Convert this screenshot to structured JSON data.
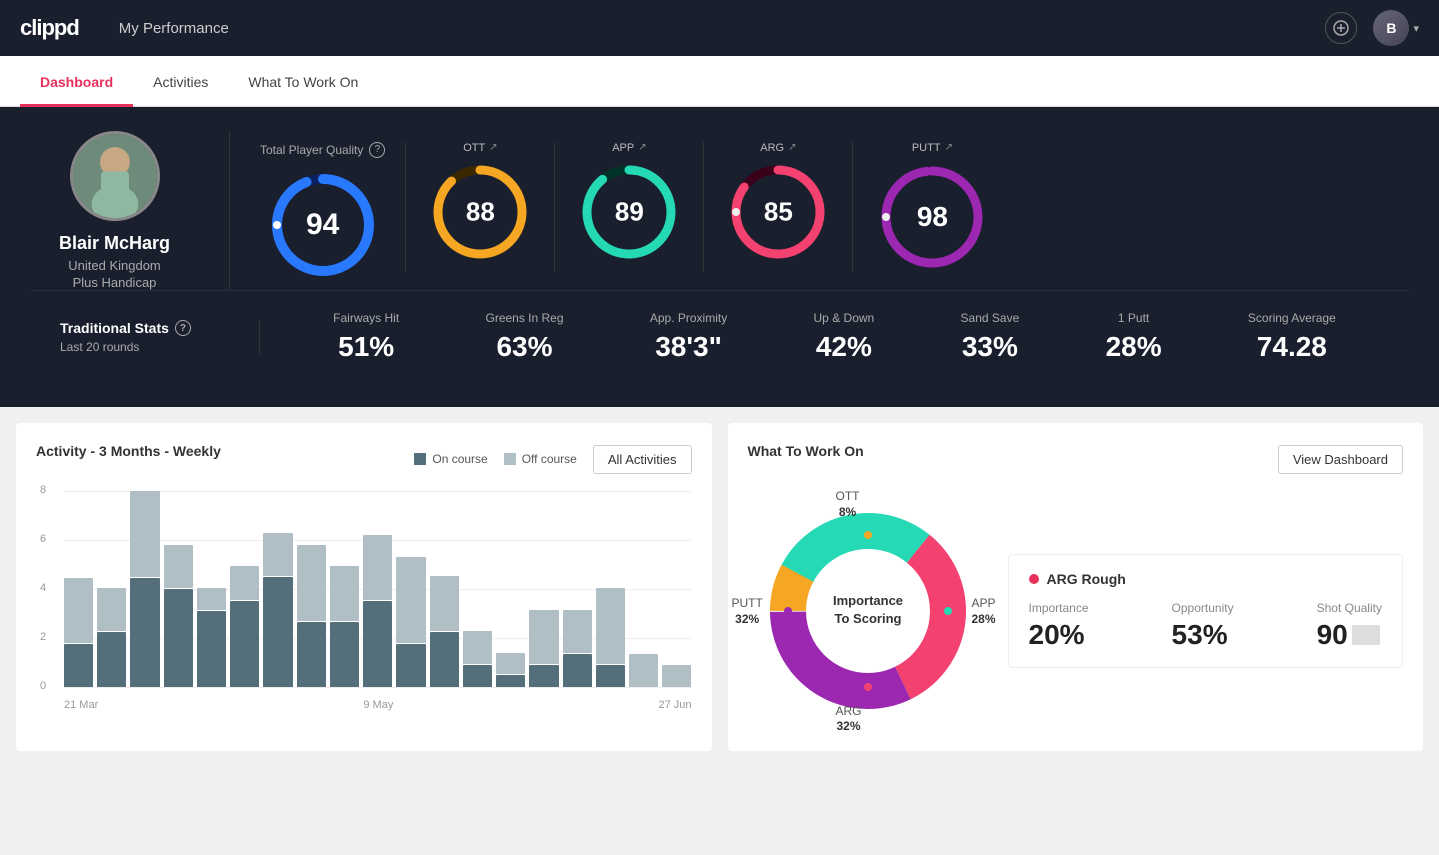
{
  "app": {
    "logo": "clippd",
    "nav_title": "My Performance"
  },
  "tabs": [
    {
      "id": "dashboard",
      "label": "Dashboard",
      "active": true
    },
    {
      "id": "activities",
      "label": "Activities",
      "active": false
    },
    {
      "id": "what-to-work-on",
      "label": "What To Work On",
      "active": false
    }
  ],
  "player": {
    "name": "Blair McHarg",
    "country": "United Kingdom",
    "handicap": "Plus Handicap",
    "avatar_initial": "B"
  },
  "quality": {
    "label": "Total Player Quality",
    "main": {
      "value": 94,
      "color": "#2979ff",
      "track": "#0d2060",
      "pct": 94
    },
    "scores": [
      {
        "label": "OTT",
        "value": 88,
        "color": "#f5a623",
        "track": "#3a2800",
        "pct": 88
      },
      {
        "label": "APP",
        "value": 89,
        "color": "#26d9b5",
        "track": "#003328",
        "pct": 89
      },
      {
        "label": "ARG",
        "value": 85,
        "color": "#f44270",
        "track": "#3a001a",
        "pct": 85
      },
      {
        "label": "PUTT",
        "value": 98,
        "color": "#9c27b0",
        "track": "#2d0040",
        "pct": 98
      }
    ]
  },
  "traditional_stats": {
    "label": "Traditional Stats",
    "help": "?",
    "period": "Last 20 rounds",
    "items": [
      {
        "name": "Fairways Hit",
        "value": "51%"
      },
      {
        "name": "Greens In Reg",
        "value": "63%"
      },
      {
        "name": "App. Proximity",
        "value": "38'3\""
      },
      {
        "name": "Up & Down",
        "value": "42%"
      },
      {
        "name": "Sand Save",
        "value": "33%"
      },
      {
        "name": "1 Putt",
        "value": "28%"
      },
      {
        "name": "Scoring Average",
        "value": "74.28"
      }
    ]
  },
  "activity_chart": {
    "title": "Activity - 3 Months - Weekly",
    "legend": {
      "on_course": "On course",
      "off_course": "Off course"
    },
    "all_activities_btn": "All Activities",
    "y_labels": [
      "8",
      "6",
      "4",
      "2",
      "0"
    ],
    "x_labels": [
      "21 Mar",
      "9 May",
      "27 Jun"
    ],
    "bars": [
      {
        "on": 8,
        "off": 12
      },
      {
        "on": 10,
        "off": 8
      },
      {
        "on": 20,
        "off": 16
      },
      {
        "on": 18,
        "off": 8
      },
      {
        "on": 14,
        "off": 4
      },
      {
        "on": 16,
        "off": 6
      },
      {
        "on": 20,
        "off": 8
      },
      {
        "on": 12,
        "off": 14
      },
      {
        "on": 12,
        "off": 10
      },
      {
        "on": 16,
        "off": 12
      },
      {
        "on": 8,
        "off": 16
      },
      {
        "on": 10,
        "off": 10
      },
      {
        "on": 4,
        "off": 6
      },
      {
        "on": 2,
        "off": 4
      },
      {
        "on": 4,
        "off": 10
      },
      {
        "on": 6,
        "off": 8
      },
      {
        "on": 4,
        "off": 14
      },
      {
        "on": 0,
        "off": 6
      },
      {
        "on": 0,
        "off": 4
      }
    ]
  },
  "what_to_work_on": {
    "title": "What To Work On",
    "view_dashboard_btn": "View Dashboard",
    "donut": {
      "center_line1": "Importance",
      "center_line2": "To Scoring",
      "segments": [
        {
          "label": "OTT\n8%",
          "color": "#f5a623",
          "pct": 8
        },
        {
          "label": "APP\n28%",
          "color": "#26d9b5",
          "pct": 28
        },
        {
          "label": "ARG\n32%",
          "color": "#f44270",
          "pct": 32
        },
        {
          "label": "PUTT\n32%",
          "color": "#9c27b0",
          "pct": 32
        }
      ]
    },
    "card": {
      "title": "ARG Rough",
      "metrics": [
        {
          "label": "Importance",
          "value": "20%"
        },
        {
          "label": "Opportunity",
          "value": "53%"
        },
        {
          "label": "Shot Quality",
          "value": "90",
          "has_badge": true
        }
      ]
    }
  }
}
